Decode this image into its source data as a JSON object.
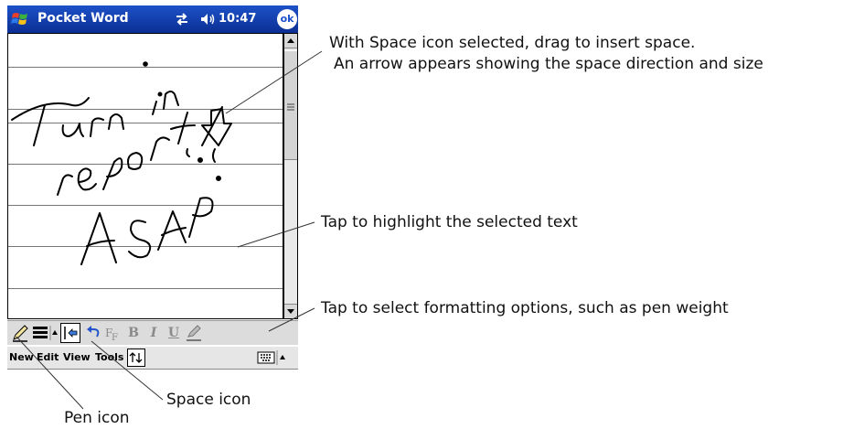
{
  "window": {
    "app_title": "Pocket Word",
    "clock": "10:47",
    "ok_label": "ok"
  },
  "document": {
    "ink_lines": [
      "Turn in",
      "report",
      "ASAP!"
    ]
  },
  "menubar": {
    "items": [
      "New",
      "Edit",
      "View",
      "Tools"
    ]
  },
  "pen_toolbar": {
    "bold_label": "B",
    "italic_label": "I",
    "underline_label": "U"
  },
  "annotations": {
    "space_drag_line1": "With Space icon selected, drag to insert space.",
    "space_drag_line2": "An arrow appears showing the space direction and size",
    "highlight": "Tap to highlight the selected text",
    "formatting": "Tap to select formatting options, such as pen weight",
    "space_icon": "Space icon",
    "pen_icon": "Pen icon"
  },
  "icons": {
    "start": "windows-flag-icon",
    "connectivity": "connection-arrows-icon",
    "volume": "speaker-icon",
    "pen": "pen-icon",
    "line_weight": "line-weight-icon",
    "space": "space-insert-icon",
    "undo": "undo-icon",
    "format": "font-format-icon",
    "highlight": "highlighter-icon",
    "keyboard": "keyboard-icon"
  }
}
